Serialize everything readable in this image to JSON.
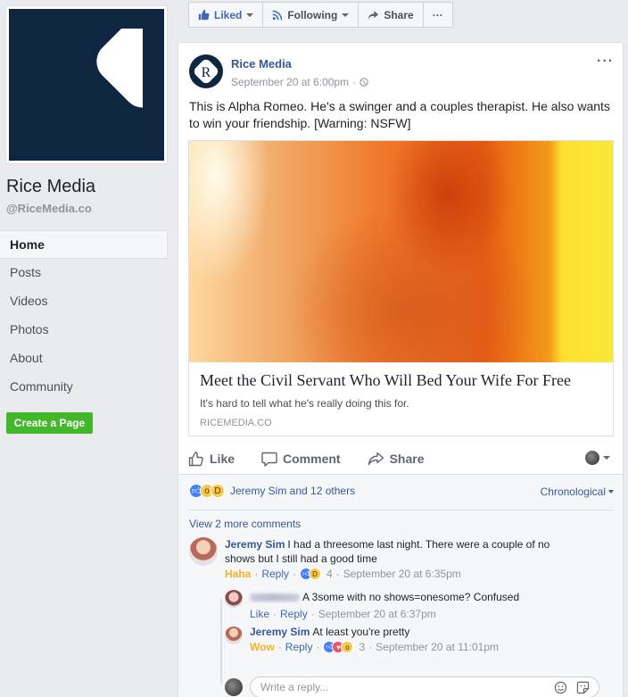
{
  "page": {
    "name": "Rice Media",
    "handle": "@RiceMedia.co",
    "logo_letter": "R",
    "brand_color": "#0f2640"
  },
  "nav": {
    "items": [
      {
        "label": "Home"
      },
      {
        "label": "Posts"
      },
      {
        "label": "Videos"
      },
      {
        "label": "Photos"
      },
      {
        "label": "About"
      },
      {
        "label": "Community"
      }
    ],
    "create_page": "Create a Page"
  },
  "action_bar": {
    "liked": "Liked",
    "following": "Following",
    "share": "Share",
    "more": "···"
  },
  "post": {
    "author": "Rice Media",
    "time": "September 20 at 6:00pm",
    "audience_icon": "globe-icon",
    "text": "This is Alpha Romeo. He's a swinger and a couples therapist. He also wants to win your friendship. [Warning: NSFW]",
    "link": {
      "title": "Meet the Civil Servant Who Will Bed Your Wife For Free",
      "description": "It's hard to tell what he's really doing this for.",
      "domain": "RICEMEDIA.CO"
    },
    "actions": {
      "like": "Like",
      "comment": "Comment",
      "share": "Share"
    },
    "reactions": {
      "types": [
        "like",
        "wow",
        "haha"
      ],
      "summary": "Jeremy Sim and 12 others"
    },
    "sort": "Chronological"
  },
  "comments": {
    "view_more": "View 2 more comments",
    "items": [
      {
        "author": "Jeremy Sim",
        "text": "I had a threesome last night. There were a couple of no shows but I still had a good time",
        "reaction_label": "Haha",
        "reply": "Reply",
        "reaction_count": "4",
        "time": "September 20 at 6:35pm"
      }
    ],
    "replies": [
      {
        "author": "",
        "text": "A 3some with no shows=onesome? Confused",
        "like": "Like",
        "reply": "Reply",
        "time": "September 20 at 6:37pm"
      },
      {
        "author": "Jeremy Sim",
        "text": "At least you're pretty",
        "reaction_label": "Wow",
        "reply": "Reply",
        "reaction_count": "3",
        "time": "September 20 at 11:01pm"
      }
    ],
    "reply_placeholder": "Write a reply..."
  },
  "colors": {
    "link_blue": "#365899",
    "create_green": "#42b72a",
    "reaction_yellow": "#f7b125"
  }
}
